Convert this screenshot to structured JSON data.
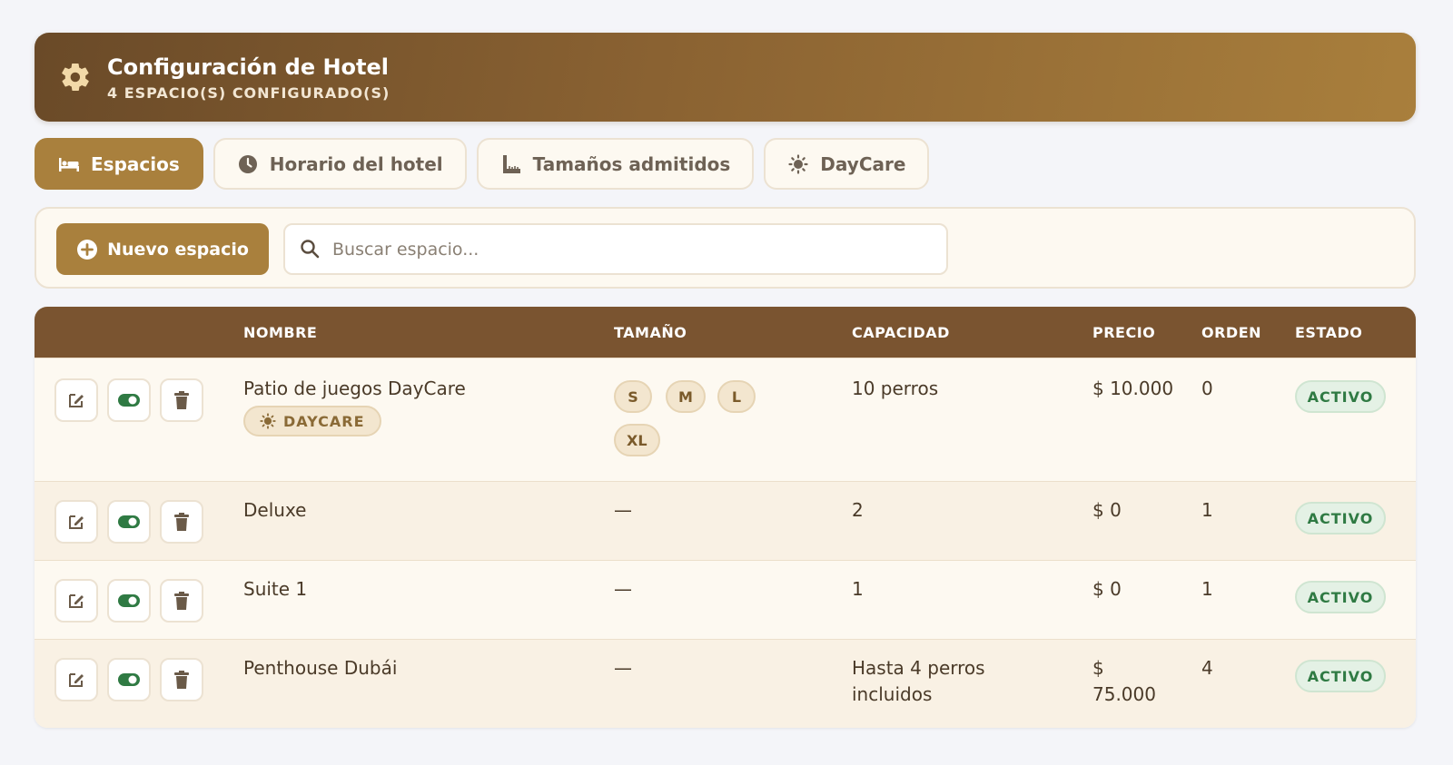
{
  "header": {
    "title": "Configuración de Hotel",
    "subtitle": "4 ESPACIO(S) CONFIGURADO(S)",
    "icon": "gear-icon"
  },
  "tabs": [
    {
      "label": "Espacios",
      "icon": "bed-icon",
      "active": true
    },
    {
      "label": "Horario del hotel",
      "icon": "clock-icon",
      "active": false
    },
    {
      "label": "Tamaños admitidos",
      "icon": "ruler-icon",
      "active": false
    },
    {
      "label": "DayCare",
      "icon": "sun-icon",
      "active": false
    }
  ],
  "toolbar": {
    "new_label": "Nuevo espacio",
    "search_placeholder": "Buscar espacio..."
  },
  "table": {
    "columns": {
      "nombre": "NOMBRE",
      "tamano": "TAMAÑO",
      "capacidad": "CAPACIDAD",
      "precio": "PRECIO",
      "orden": "ORDEN",
      "estado": "ESTADO"
    },
    "rows": [
      {
        "nombre": "Patio de juegos DayCare",
        "tag": "DAYCARE",
        "sizes": [
          "S",
          "M",
          "L",
          "XL"
        ],
        "capacidad": "10 perros",
        "precio": "$ 10.000",
        "orden": "0",
        "estado": "ACTIVO"
      },
      {
        "nombre": "Deluxe",
        "tamano": "—",
        "capacidad": "2",
        "precio": "$ 0",
        "orden": "1",
        "estado": "ACTIVO"
      },
      {
        "nombre": "Suite 1",
        "tamano": "—",
        "capacidad": "1",
        "precio": "$ 0",
        "orden": "1",
        "estado": "ACTIVO"
      },
      {
        "nombre": "Penthouse Dubái",
        "tamano": "—",
        "capacidad_line1": "Hasta 4 perros",
        "capacidad_line2": "incluidos",
        "precio_line1": "$",
        "precio_line2": "75.000",
        "orden": "4",
        "estado": "ACTIVO"
      }
    ]
  },
  "colors": {
    "brand": "#a9803d",
    "header_dark": "#7a5430",
    "status_green": "#2f7a43"
  }
}
